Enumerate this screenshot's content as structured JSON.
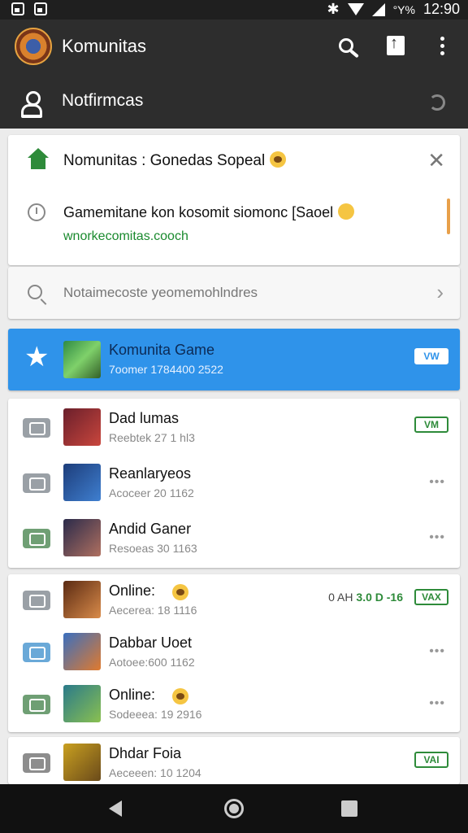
{
  "status_bar": {
    "signal_text": "°Y%",
    "time": "12:90"
  },
  "app_bar": {
    "title": "Komunitas",
    "notifications_label": "Notfirmcas"
  },
  "pinned_card": {
    "title": "Nomunitas : Gonedas Sopeal",
    "description": "Gamemitane kon kosomit siomonc [Saoel",
    "link": "wnorkecomitas.cooch"
  },
  "search_card": {
    "text": "Notaimecoste yeomemohlndres"
  },
  "featured": {
    "title": "Komunita Game",
    "subtitle": "7oomer 1784400 2522",
    "badge": "VW"
  },
  "group1": [
    {
      "title": "Dad lumas",
      "subtitle": "Reebtek 27 1 hl3",
      "trailing": "badge",
      "badge": "VM",
      "icon": "gray",
      "thumb": [
        "#6a1f2b",
        "#c9463d"
      ]
    },
    {
      "title": "Reanlaryeos",
      "subtitle": "Acoceer 20 1162",
      "trailing": "more",
      "icon": "gray",
      "thumb": [
        "#1d3d7a",
        "#3f7fd0"
      ]
    },
    {
      "title": "Andid Ganer",
      "subtitle": "Resoeas 30 1163",
      "trailing": "more",
      "icon": "green",
      "thumb": [
        "#2a2a4a",
        "#b07060"
      ]
    }
  ],
  "group2": [
    {
      "title": "Online:",
      "subtitle": "Aecerea: 18 1116",
      "trailing": "badge",
      "badge": "VAX",
      "stats": "0 AH",
      "stats_green": "3.0 D -16",
      "icon": "gray",
      "thumb": [
        "#5a2a12",
        "#d98b4a"
      ],
      "emoji": true
    },
    {
      "title": "Dabbar Uoet",
      "subtitle": "Aotoee:600 1162",
      "trailing": "more",
      "icon": "blue",
      "thumb": [
        "#3a6fbf",
        "#e07a2e"
      ]
    },
    {
      "title": "Online:",
      "subtitle": "Sodeeea: 19 2916",
      "trailing": "more",
      "icon": "green",
      "thumb": [
        "#2a7a8a",
        "#8ac050"
      ],
      "emoji": true
    }
  ],
  "group3": [
    {
      "title": "Dhdar Foia",
      "subtitle": "Aeceeen: 10 1204",
      "trailing": "badge",
      "badge": "VAI",
      "icon": "ppl",
      "thumb": [
        "#c9a020",
        "#6a4a1a"
      ]
    }
  ],
  "colors": {
    "appbar": "#2d2d2d",
    "accent_blue": "#2f93ea",
    "accent_green": "#2e8b3a"
  }
}
